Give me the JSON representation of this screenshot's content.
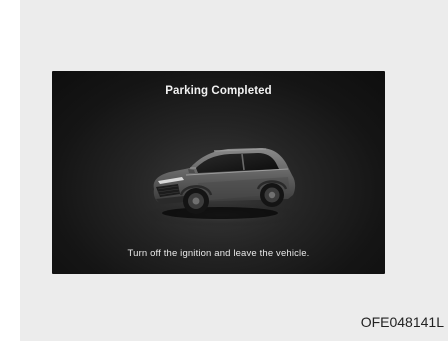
{
  "display": {
    "title": "Parking Completed",
    "message": "Turn off the ignition and leave the vehicle.",
    "vehicle_icon": "suv-car-icon",
    "background_color": "#151515",
    "text_color": "#f2f2f2"
  },
  "figure": {
    "code": "OFE048141L"
  }
}
